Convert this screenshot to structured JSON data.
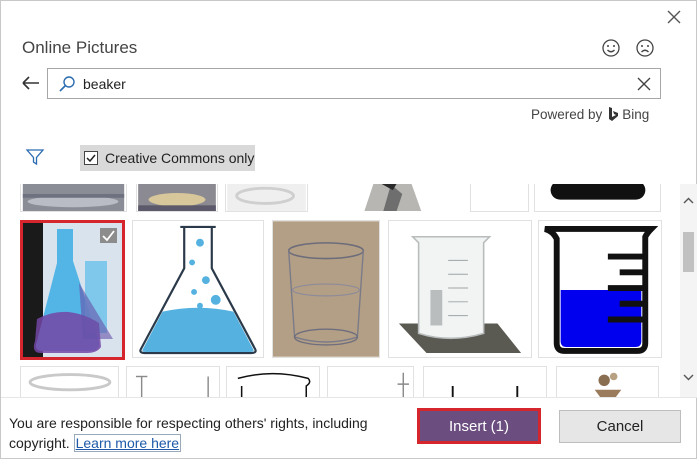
{
  "dialog": {
    "title": "Online Pictures",
    "feedback": {
      "smile_icon": "smile-icon",
      "frown_icon": "frown-icon"
    }
  },
  "search": {
    "value": "beaker",
    "placeholder": "",
    "clear_icon": "close-icon",
    "search_icon": "search-icon"
  },
  "powered_by": {
    "label": "Powered by",
    "brand": "Bing"
  },
  "filters": {
    "filter_icon": "filter-icon",
    "creative_commons_label": "Creative Commons only",
    "creative_commons_checked": true
  },
  "results": {
    "row_partial_top": [
      "ice-tray",
      "liquid-dish",
      "glass-vessel",
      "lab-person",
      "white-tile",
      "black-dish"
    ],
    "row_main": [
      "blue-flasks",
      "erlenmeyer-flask",
      "beaker-outline",
      "glass-beaker",
      "blue-beaker"
    ],
    "row_bottom": [
      "glass-bowl",
      "lab-stand",
      "sketch-beaker",
      "stand-2",
      "measuring-cylinder",
      "burner"
    ],
    "selected_index": 0
  },
  "footer": {
    "disclaimer": "You are responsible for respecting others' rights, including copyright.",
    "learn_more": "Learn more here",
    "insert_label": "Insert (1)",
    "cancel_label": "Cancel"
  },
  "colors": {
    "accent": "#6b4d7f",
    "selection": "#d4262c",
    "link": "#1e5aa8"
  }
}
